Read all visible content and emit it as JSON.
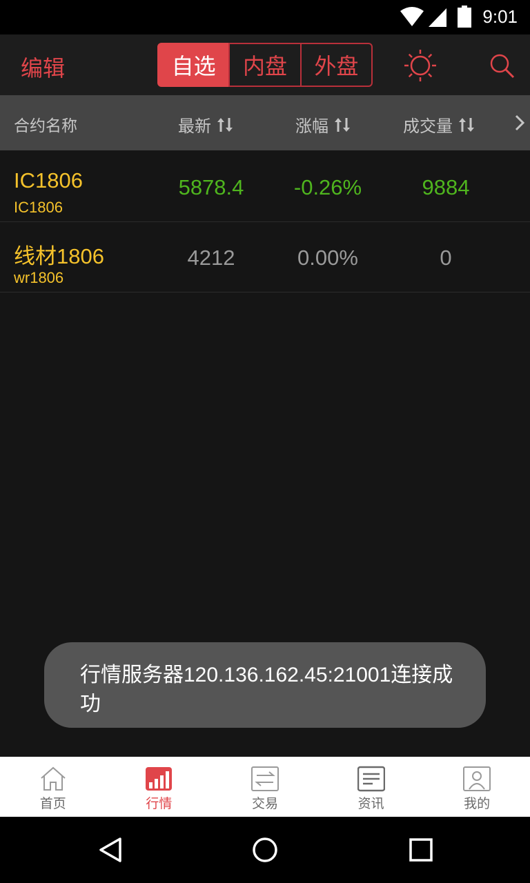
{
  "status_bar": {
    "time": "9:01",
    "icons": [
      "wifi-icon",
      "signal-icon",
      "battery-icon"
    ]
  },
  "top_bar": {
    "edit_label": "编辑",
    "segments": [
      "自选",
      "内盘",
      "外盘"
    ],
    "active_segment": "自选",
    "icons": [
      "sun-icon",
      "search-icon"
    ]
  },
  "table": {
    "headers": {
      "name": "合约名称",
      "latest": "最新",
      "change": "涨幅",
      "volume": "成交量"
    },
    "rows": [
      {
        "name": "IC1806",
        "code": "IC1806",
        "latest": "5878.4",
        "change": "-0.26%",
        "volume": "9884"
      },
      {
        "name": "线材1806",
        "code": "wr1806",
        "latest": "4212",
        "change": "0.00%",
        "volume": "0"
      }
    ]
  },
  "toast": {
    "message": "行情服务器120.136.162.45:21001连接成功"
  },
  "tab_bar": {
    "tabs": [
      {
        "label": "首页",
        "icon": "home-icon"
      },
      {
        "label": "行情",
        "icon": "chart-bars-icon"
      },
      {
        "label": "交易",
        "icon": "exchange-icon"
      },
      {
        "label": "资讯",
        "icon": "news-icon"
      },
      {
        "label": "我的",
        "icon": "profile-icon"
      }
    ],
    "active": "行情"
  },
  "colors": {
    "accent": "#e0454a",
    "down": "#4fb51e",
    "flat": "#9a9a9a",
    "contract": "#f5c22b"
  }
}
